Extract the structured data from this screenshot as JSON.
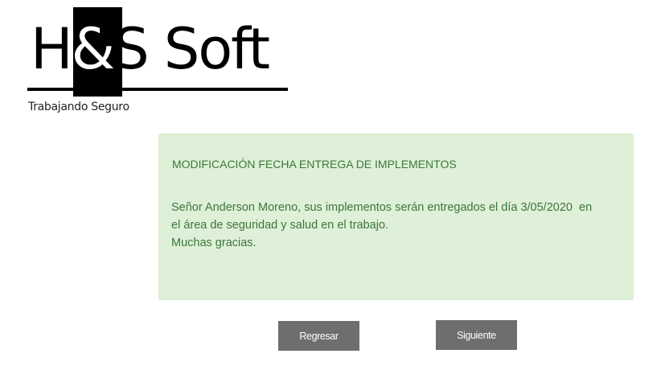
{
  "logo": {
    "text_before": "H",
    "text_amp": "&",
    "text_after": "S Soft",
    "tagline": "Trabajando Seguro"
  },
  "alert": {
    "title": "MODIFICACIÓN FECHA ENTREGA DE IMPLEMENTOS",
    "line1": "Señor Anderson Moreno, sus implementos serán entregados el día 3/05/2020  en",
    "line2": "el área de seguridad y salud en el trabajo.",
    "line3": "Muchas gracias.",
    "background_color": "#dff0d8",
    "text_color": "#3c763d"
  },
  "buttons": {
    "back_label": "Regresar",
    "next_label": "Siguiente",
    "color": "#6e6e6e"
  }
}
